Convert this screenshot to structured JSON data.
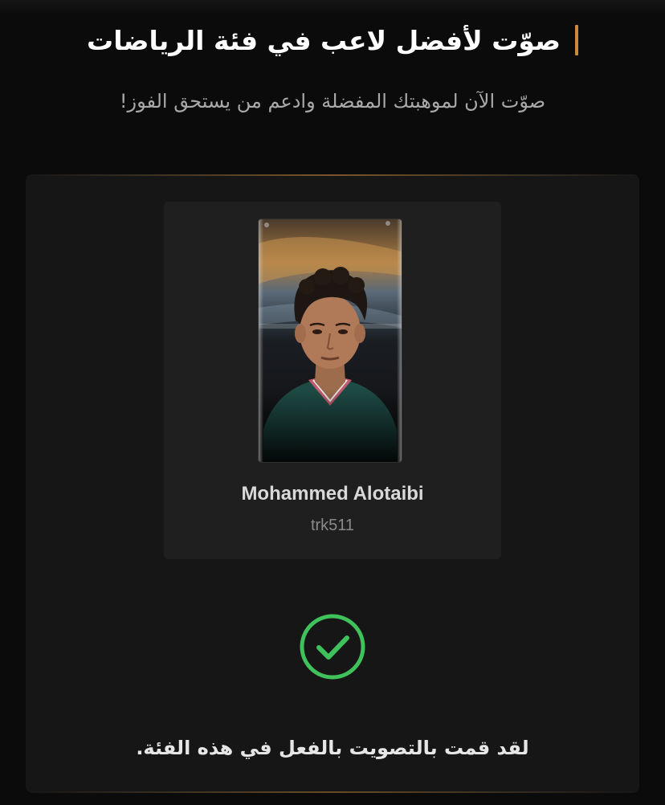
{
  "header": {
    "title": "صوّت لأفضل لاعب في فئة الرياضات",
    "subtitle": "صوّت الآن لموهبتك المفضلة وادعم من يستحق الفوز!"
  },
  "nominee": {
    "name": "Mohammed Alotaibi",
    "handle": "trk511"
  },
  "status": {
    "message": "لقد قمت بالتصويت بالفعل في هذه الفئة.",
    "icon": "check-circle-icon",
    "color": "#3fc15b"
  },
  "colors": {
    "accent": "#c98a3e",
    "background": "#0b0b0b",
    "panel": "#161616",
    "card": "#1f1f1f"
  }
}
